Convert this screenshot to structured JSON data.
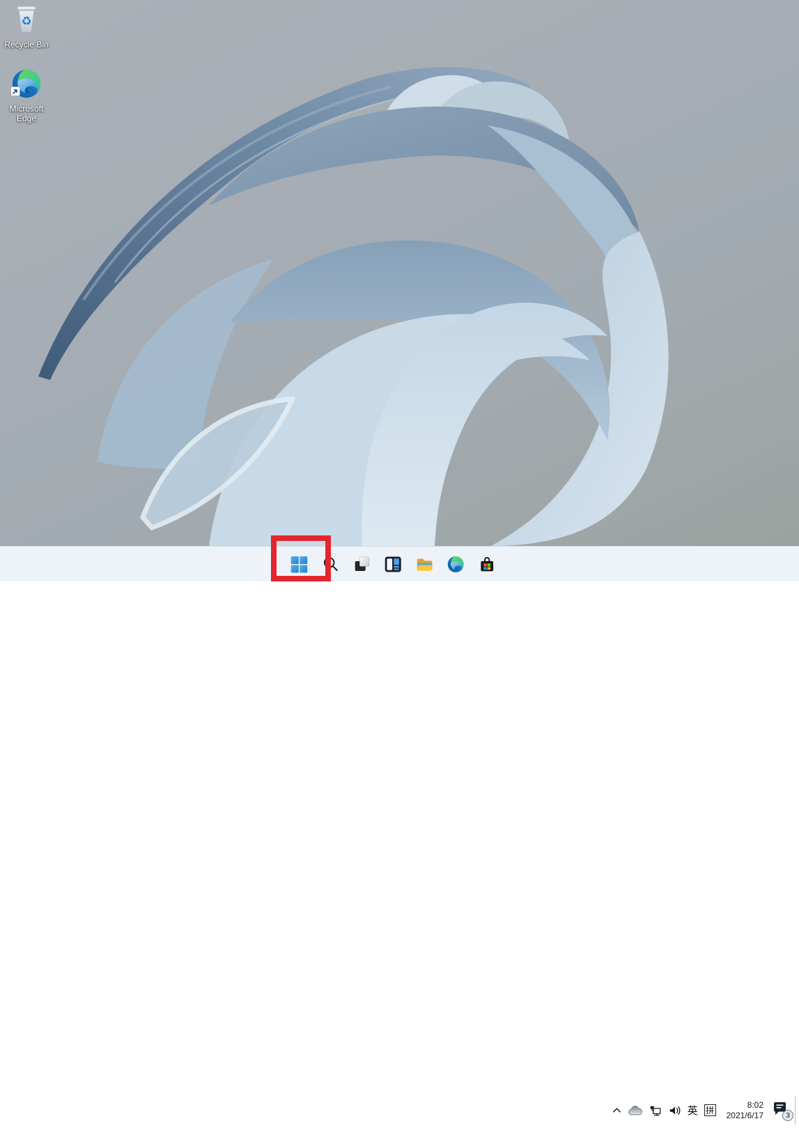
{
  "desktop": {
    "icons": [
      {
        "name": "recycle-bin",
        "label": "Recycle Bin"
      },
      {
        "name": "microsoft-edge-shortcut",
        "label": "Microsoft Edge"
      }
    ]
  },
  "taskbar": {
    "buttons": [
      {
        "name": "start",
        "icon": "windows-logo"
      },
      {
        "name": "search",
        "icon": "magnifier"
      },
      {
        "name": "task-view",
        "icon": "overlapping-windows"
      },
      {
        "name": "widgets",
        "icon": "widgets-panel"
      },
      {
        "name": "file-explorer",
        "icon": "folder"
      },
      {
        "name": "edge-browser",
        "icon": "edge-swirl"
      },
      {
        "name": "microsoft-store",
        "icon": "shopping-bag"
      }
    ]
  },
  "tray": {
    "hidden_icons": "chevron-up",
    "status_icons": [
      "onedrive-cloud",
      "network-ethernet",
      "volume"
    ],
    "ime_language": "英",
    "ime_mode": "拼",
    "clock": {
      "time": "8:02",
      "date": "2021/6/17"
    },
    "notifications": {
      "badge_count": "3"
    }
  },
  "annotation": {
    "shape": "rectangle",
    "color": "#e2262b",
    "target": "start-button"
  },
  "colors": {
    "taskbar_bg": "#eef3f9",
    "wallpaper_gray": "#a6adb4",
    "start_blue": "#2a8fd8"
  }
}
